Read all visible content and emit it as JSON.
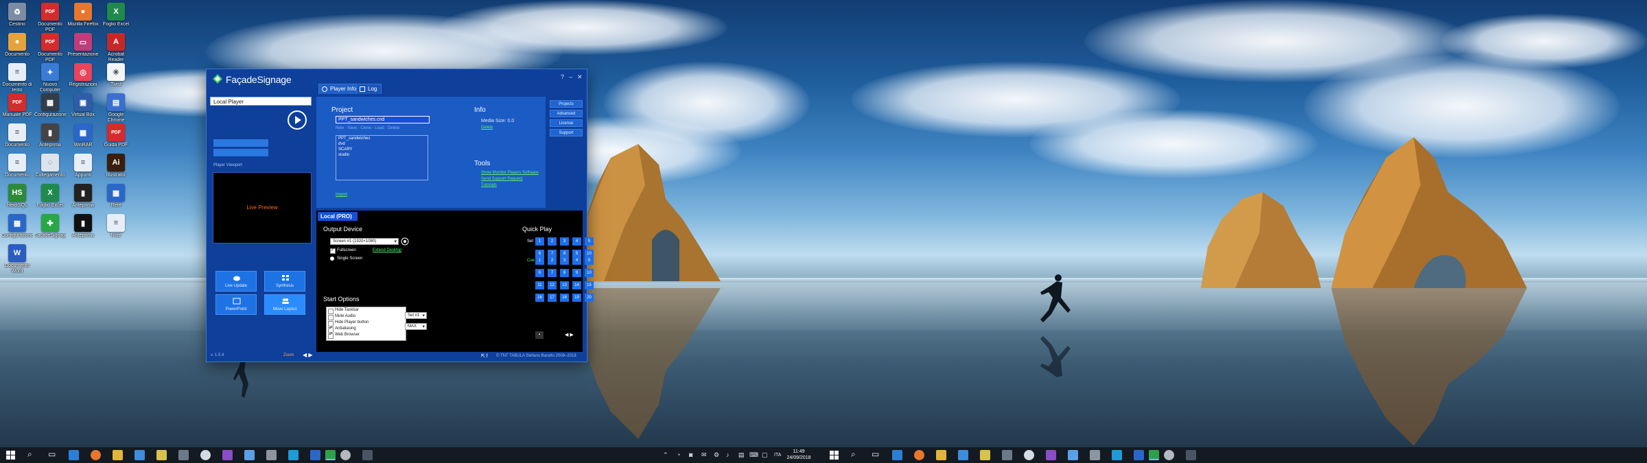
{
  "desktop_icons": [
    {
      "label": "Cestino",
      "color": "#7c8da3",
      "glyph": "♻"
    },
    {
      "label": "Documento PDF",
      "color": "#d42b2b",
      "glyph": "PDF"
    },
    {
      "label": "Mozilla Firefox",
      "color": "#e8762c",
      "glyph": "●"
    },
    {
      "label": "Foglio Excel",
      "color": "#1f8a4c",
      "glyph": "X"
    },
    {
      "label": "Documento",
      "color": "#e8a23c",
      "glyph": "●"
    },
    {
      "label": "Documento PDF",
      "color": "#d42b2b",
      "glyph": "PDF"
    },
    {
      "label": "Presentazione",
      "color": "#c23b7a",
      "glyph": "▭"
    },
    {
      "label": "Acrobat Reader",
      "color": "#c62828",
      "glyph": "A"
    },
    {
      "label": "Documento di testo",
      "color": "#e8eef6",
      "glyph": "≡"
    },
    {
      "label": "Nuovo Computer",
      "color": "#3a7bd5",
      "glyph": "✦"
    },
    {
      "label": "Registrazioni",
      "color": "#e8445a",
      "glyph": "◎"
    },
    {
      "label": "Twist",
      "color": "#f4f4f4",
      "glyph": "✳"
    },
    {
      "label": "Manuale PDF",
      "color": "#d42b2b",
      "glyph": "PDF"
    },
    {
      "label": "Configurazione",
      "color": "#333c48",
      "glyph": "▦"
    },
    {
      "label": "Virtual Box",
      "color": "#2e5ea8",
      "glyph": "▣"
    },
    {
      "label": "Google Chrome",
      "color": "#3a6fd0",
      "glyph": "▤"
    },
    {
      "label": "Documento",
      "color": "#e8eef6",
      "glyph": "≡"
    },
    {
      "label": "Anteprima",
      "color": "#444",
      "glyph": "▮"
    },
    {
      "label": "WinRAR",
      "color": "#2b67c9",
      "glyph": "▦"
    },
    {
      "label": "Guida PDF",
      "color": "#d42b2b",
      "glyph": "PDF"
    },
    {
      "label": "Documento",
      "color": "#e8eef6",
      "glyph": "≡"
    },
    {
      "label": "Collegamento",
      "color": "#dde3ea",
      "glyph": "◌"
    },
    {
      "label": "Appunti",
      "color": "#e8eef6",
      "glyph": "≡"
    },
    {
      "label": "Illustrator",
      "color": "#3b1d0c",
      "glyph": "Ai"
    },
    {
      "label": "HeidiSQL",
      "color": "#2d8a3a",
      "glyph": "HS"
    },
    {
      "label": "Foglio Excel",
      "color": "#1f8a4c",
      "glyph": "X"
    },
    {
      "label": "Anteprima",
      "color": "#222",
      "glyph": "▮"
    },
    {
      "label": "Rete",
      "color": "#2b67c9",
      "glyph": "▦"
    },
    {
      "label": "Configurazione",
      "color": "#2b67c9",
      "glyph": "▦"
    },
    {
      "label": "FacadeSignage",
      "color": "#28a745",
      "glyph": "✚"
    },
    {
      "label": "Anteprima",
      "color": "#111",
      "glyph": "▮"
    },
    {
      "label": "Note",
      "color": "#e8eef6",
      "glyph": "≡"
    },
    {
      "label": "Documento Word",
      "color": "#2b5cc0",
      "glyph": "W"
    }
  ],
  "app": {
    "title": "FaçadeSignage",
    "window_controls": [
      "?",
      "–",
      "✕"
    ],
    "tabs": [
      {
        "label": "Player Info"
      },
      {
        "label": "Log"
      }
    ],
    "player_select": "Local Player",
    "player_label": "Player Viewport",
    "preview_text": "Live Preview",
    "tiles": [
      {
        "label": "Live Update"
      },
      {
        "label": "Synthesis"
      },
      {
        "label": "PowerPoint"
      },
      {
        "label": "Move Layout"
      }
    ],
    "version": "v. 1.5.4",
    "zoom": "Zoom",
    "project": {
      "heading": "Project",
      "current": "PPT_sandwiches.cnd",
      "actions": "New · Save · Clone · Load · Delete",
      "items": [
        "PPT_sandwiches",
        "dvd",
        "SCARY",
        "studio"
      ],
      "import_link": "Import"
    },
    "info": {
      "heading": "Info",
      "media_size_label": "Media Size: 0.0",
      "media_link": "Delete"
    },
    "tools": {
      "heading": "Tools",
      "links": [
        "Show Monitor Players Software",
        "Send Support Request",
        "Tutorials"
      ]
    },
    "side_buttons": [
      "Projects",
      "Advanced",
      "License",
      "Support"
    ],
    "pro": {
      "heading": "Local (PRO)",
      "output_heading": "Output Device",
      "screen_select": "Screen #1  (1920×1080)",
      "fullscreen": "Fullscreen",
      "extend_link": "Extend Desktop",
      "single_screen": "Single Screen",
      "start_heading": "Start Options",
      "start_options": [
        "Hide Taskbar",
        "Mute Audio",
        "Hide Player button",
        "Antialiasing",
        "Web Browser"
      ],
      "start_set_label": "Start Set",
      "start_set_value": "Set #1",
      "fps_label": "FPS",
      "fps_value": "MAX",
      "quick_play_heading": "Quick Play",
      "set_label": "Set",
      "cue_label": "Cue",
      "set_buttons": [
        "1",
        "2",
        "3",
        "4",
        "5",
        "6",
        "7",
        "8",
        "9",
        "10"
      ],
      "cue_buttons": [
        "1",
        "2",
        "3",
        "4",
        "5",
        "6",
        "7",
        "8",
        "9",
        "10",
        "11",
        "12",
        "13",
        "14",
        "15",
        "16",
        "17",
        "18",
        "19",
        "20"
      ]
    },
    "copyright": "© TNT TABULA Stefano Baratto 2008–2018"
  },
  "taskbar": {
    "time": "11:49",
    "date": "24/09/2018",
    "lang": "ITA"
  }
}
